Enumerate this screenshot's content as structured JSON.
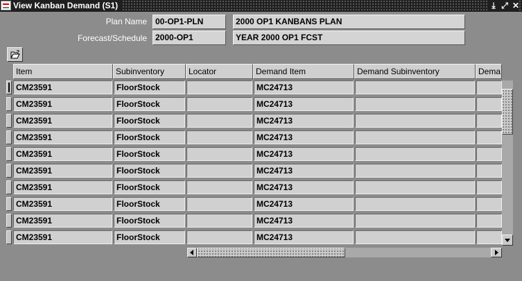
{
  "window": {
    "title": "View Kanban Demand (S1)",
    "controls": [
      "minimize-icon",
      "maximize-icon",
      "close-icon"
    ],
    "control_glyphs": [
      "⤓",
      "⤢",
      "✕"
    ]
  },
  "header": {
    "plan_name_label": "Plan Name",
    "plan_name_value": "00-OP1-PLN",
    "plan_desc_value": "2000 OP1 KANBANS PLAN",
    "forecast_label": "Forecast/Schedule",
    "forecast_value": "2000-OP1",
    "forecast_desc_value": "YEAR 2000 OP1 FCST"
  },
  "toolbar": {
    "folder_icon": "folder-open-icon"
  },
  "table": {
    "columns": [
      "Item",
      "Subinventory",
      "Locator",
      "Demand Item",
      "Demand Subinventory",
      "Dema"
    ],
    "rows": [
      [
        "CM23591",
        "FloorStock",
        "",
        "MC24713",
        "",
        ""
      ],
      [
        "CM23591",
        "FloorStock",
        "",
        "MC24713",
        "",
        ""
      ],
      [
        "CM23591",
        "FloorStock",
        "",
        "MC24713",
        "",
        ""
      ],
      [
        "CM23591",
        "FloorStock",
        "",
        "MC24713",
        "",
        ""
      ],
      [
        "CM23591",
        "FloorStock",
        "",
        "MC24713",
        "",
        ""
      ],
      [
        "CM23591",
        "FloorStock",
        "",
        "MC24713",
        "",
        ""
      ],
      [
        "CM23591",
        "FloorStock",
        "",
        "MC24713",
        "",
        ""
      ],
      [
        "CM23591",
        "FloorStock",
        "",
        "MC24713",
        "",
        ""
      ],
      [
        "CM23591",
        "FloorStock",
        "",
        "MC24713",
        "",
        ""
      ],
      [
        "CM23591",
        "FloorStock",
        "",
        "MC24713",
        "",
        ""
      ]
    ]
  },
  "scrollbars": {
    "vertical_up_icon": "arrow-up-icon",
    "vertical_down_icon": "arrow-down-icon",
    "horizontal_left_icon": "arrow-left-icon",
    "horizontal_right_icon": "arrow-right-icon"
  }
}
